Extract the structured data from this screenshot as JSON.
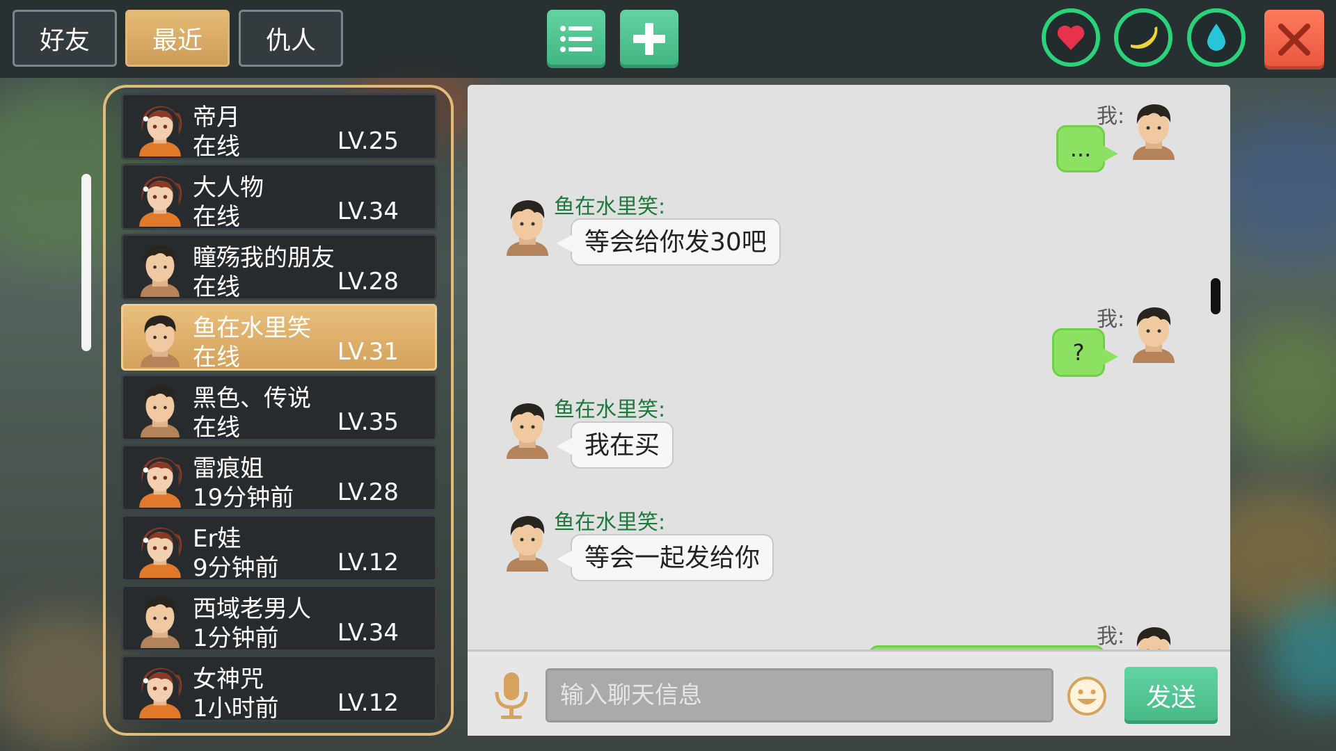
{
  "tabs": [
    {
      "label": "好友"
    },
    {
      "label": "最近"
    },
    {
      "label": "仇人"
    }
  ],
  "active_tab": "最近",
  "top_icons": [
    "list-icon",
    "plus-icon",
    "heart-icon",
    "banana-icon",
    "water-drop-icon",
    "close-icon"
  ],
  "colors": {
    "accent_gold": "#d9a863",
    "accent_green": "#4cc08e",
    "ring_green": "#2ad37a",
    "close_red": "#e8553d",
    "my_bubble": "#8ce163"
  },
  "friends": [
    {
      "name": "帝月",
      "status": "在线",
      "level": "LV.25",
      "avatar": "girl-avatar"
    },
    {
      "name": "大人物",
      "status": "在线",
      "level": "LV.34",
      "avatar": "girl-avatar"
    },
    {
      "name": "瞳殇我的朋友",
      "status": "在线",
      "level": "LV.28",
      "avatar": "boy-avatar"
    },
    {
      "name": "鱼在水里笑",
      "status": "在线",
      "level": "LV.31",
      "avatar": "boy-avatar",
      "selected": true
    },
    {
      "name": "黑色、传说",
      "status": "在线",
      "level": "LV.35",
      "avatar": "boy-avatar"
    },
    {
      "name": "雷痕姐",
      "status": "19分钟前",
      "level": "LV.28",
      "avatar": "girl-avatar"
    },
    {
      "name": "Er娃",
      "status": "9分钟前",
      "level": "LV.12",
      "avatar": "girl-avatar"
    },
    {
      "name": "西域老男人",
      "status": "1分钟前",
      "level": "LV.34",
      "avatar": "boy-avatar"
    },
    {
      "name": "女神咒",
      "status": "1小时前",
      "level": "LV.12",
      "avatar": "girl-avatar"
    }
  ],
  "chat": {
    "me_label": "我:",
    "messages": [
      {
        "from": "me",
        "text": "..."
      },
      {
        "from": "other",
        "sender": "鱼在水里笑:",
        "text": "等会给你发30吧"
      },
      {
        "from": "me",
        "text": "?"
      },
      {
        "from": "other",
        "sender": "鱼在水里笑:",
        "text": "我在买"
      },
      {
        "from": "other",
        "sender": "鱼在水里笑:",
        "text": "等会一起发给你"
      },
      {
        "from": "me",
        "text": ""
      }
    ],
    "input_placeholder": "输入聊天信息",
    "input_value": "",
    "send_label": "发送"
  }
}
